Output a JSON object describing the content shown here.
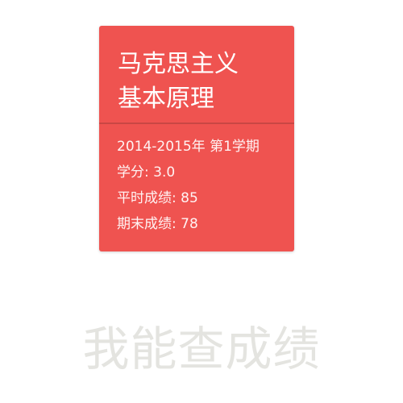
{
  "course": {
    "title_line1": "马克思主义",
    "title_line2": "基本原理",
    "term": "2014-2015年 第1学期",
    "credit": "学分: 3.0",
    "usual_score": "平时成绩: 85",
    "final_score": "期末成绩: 78"
  },
  "footer": {
    "app_name": "我能查成绩"
  },
  "colors": {
    "card_background": "#ef5350",
    "card_divider": "#c94744",
    "footer_text": "#e4e4e0"
  }
}
